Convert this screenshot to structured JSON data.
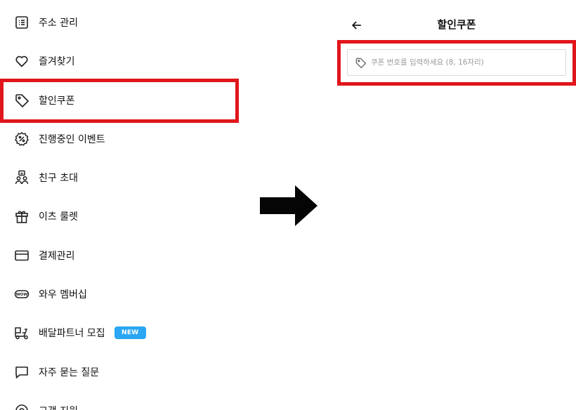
{
  "menu": {
    "items": [
      {
        "label": "주소 관리",
        "icon": "address-list-icon"
      },
      {
        "label": "즐겨찾기",
        "icon": "heart-icon"
      },
      {
        "label": "할인쿠폰",
        "icon": "coupon-tag-icon"
      },
      {
        "label": "진행중인 이벤트",
        "icon": "percent-badge-icon"
      },
      {
        "label": "친구 초대",
        "icon": "invite-friends-icon"
      },
      {
        "label": "이츠 룰렛",
        "icon": "gift-icon"
      },
      {
        "label": "결제관리",
        "icon": "card-icon"
      },
      {
        "label": "와우 멤버십",
        "icon": "wow-icon"
      },
      {
        "label": "배달파트너 모집",
        "icon": "delivery-scooter-icon",
        "badge": "NEW"
      },
      {
        "label": "자주 묻는 질문",
        "icon": "chat-bubble-icon"
      },
      {
        "label": "고객 지원",
        "icon": "support-icon"
      }
    ]
  },
  "coupon_screen": {
    "title": "할인쿠폰",
    "input_placeholder": "쿠폰 번호를 입력하세요 (8, 16자리)"
  },
  "colors": {
    "highlight": "#e0161b",
    "badge": "#2aa6f2",
    "text": "#111111",
    "placeholder": "#9a9a9a"
  }
}
